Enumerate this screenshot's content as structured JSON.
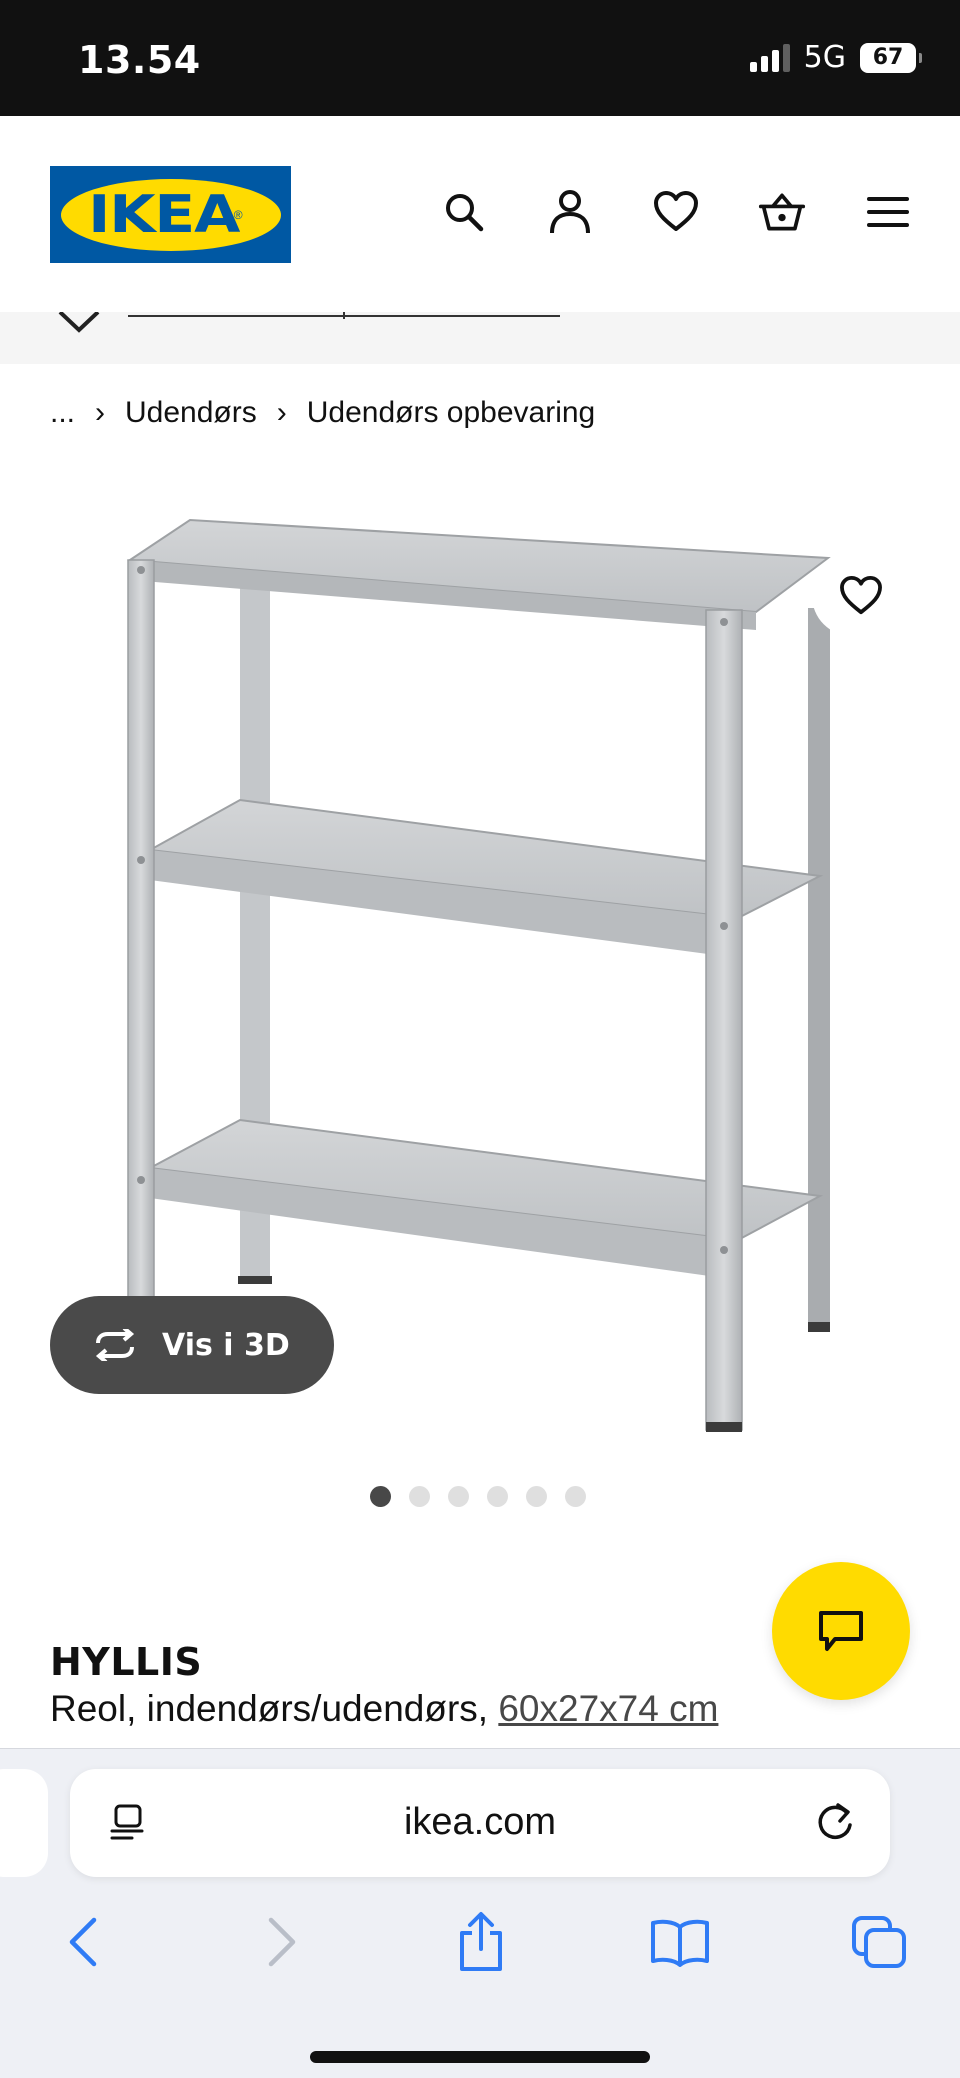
{
  "status_bar": {
    "time": "13.54",
    "network": "5G",
    "battery": "67"
  },
  "header": {
    "logo_text": "IKEA",
    "logo_reg": "®",
    "icons": [
      "search-icon",
      "account-icon",
      "heart-icon",
      "basket-icon",
      "menu-icon"
    ],
    "brand_colors": {
      "blue": "#0058a3",
      "yellow": "#ffdb00"
    }
  },
  "breadcrumb": {
    "items": [
      "...",
      "Udendørs",
      "Udendørs opbevaring"
    ],
    "separator": "›"
  },
  "gallery": {
    "view_3d_label": "Vis i 3D",
    "dots_total": 6,
    "active_index": 0
  },
  "product": {
    "name": "HYLLIS",
    "description": "Reol, indendørs/udendørs,",
    "size": "60x27x74 cm"
  },
  "browser": {
    "url": "ikea.com"
  }
}
